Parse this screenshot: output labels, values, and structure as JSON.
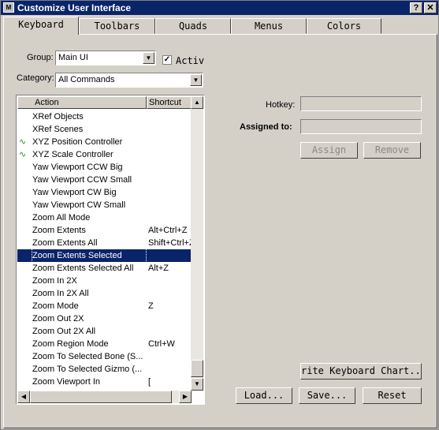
{
  "window": {
    "title": "Customize User Interface",
    "help_glyph": "?",
    "close_glyph": "✕",
    "app_icon_glyph": "M"
  },
  "tabs": [
    {
      "label": "Keyboard",
      "active": true
    },
    {
      "label": "Toolbars"
    },
    {
      "label": "Quads"
    },
    {
      "label": "Menus"
    },
    {
      "label": "Colors"
    }
  ],
  "group": {
    "label": "Group:",
    "value": "Main UI"
  },
  "active": {
    "label": "Activ",
    "checked": true,
    "check_glyph": "✓"
  },
  "category": {
    "label": "Category:",
    "value": "All Commands"
  },
  "list": {
    "columns": {
      "action": "Action",
      "shortcut": "Shortcut"
    },
    "rows": [
      {
        "action": "XRef Objects",
        "shortcut": ""
      },
      {
        "action": "XRef Scenes",
        "shortcut": ""
      },
      {
        "action": "XYZ Position Controller",
        "shortcut": "",
        "icon": "controller-icon"
      },
      {
        "action": "XYZ Scale Controller",
        "shortcut": "",
        "icon": "controller-icon"
      },
      {
        "action": "Yaw Viewport CCW Big",
        "shortcut": ""
      },
      {
        "action": "Yaw Viewport CCW Small",
        "shortcut": ""
      },
      {
        "action": "Yaw Viewport CW Big",
        "shortcut": ""
      },
      {
        "action": "Yaw Viewport CW Small",
        "shortcut": ""
      },
      {
        "action": "Zoom All Mode",
        "shortcut": ""
      },
      {
        "action": "Zoom Extents",
        "shortcut": "Alt+Ctrl+Z"
      },
      {
        "action": "Zoom Extents All",
        "shortcut": "Shift+Ctrl+Z"
      },
      {
        "action": "Zoom Extents Selected",
        "shortcut": "",
        "selected": true
      },
      {
        "action": "Zoom Extents Selected All",
        "shortcut": "Alt+Z"
      },
      {
        "action": "Zoom In 2X",
        "shortcut": ""
      },
      {
        "action": "Zoom In 2X All",
        "shortcut": ""
      },
      {
        "action": "Zoom Mode",
        "shortcut": "Z"
      },
      {
        "action": "Zoom Out 2X",
        "shortcut": ""
      },
      {
        "action": "Zoom Out 2X All",
        "shortcut": ""
      },
      {
        "action": "Zoom Region Mode",
        "shortcut": "Ctrl+W"
      },
      {
        "action": "Zoom To Selected Bone (S...",
        "shortcut": ""
      },
      {
        "action": "Zoom To Selected Gizmo (...",
        "shortcut": ""
      },
      {
        "action": "Zoom Viewport In",
        "shortcut": "["
      }
    ]
  },
  "hotkey": {
    "label": "Hotkey:",
    "value": ""
  },
  "assigned_to": {
    "label": "Assigned to:",
    "value": ""
  },
  "buttons": {
    "assign": "Assign",
    "remove": "Remove",
    "write_chart": "rite Keyboard Chart...",
    "load": "Load...",
    "save": "Save...",
    "reset": "Reset"
  },
  "glyphs": {
    "up": "▲",
    "down": "▼",
    "left": "◀",
    "right": "▶",
    "controller": "∿"
  },
  "colors": {
    "titlebar": "#0a246a",
    "selection": "#0a246a",
    "face": "#d4d0c8"
  }
}
